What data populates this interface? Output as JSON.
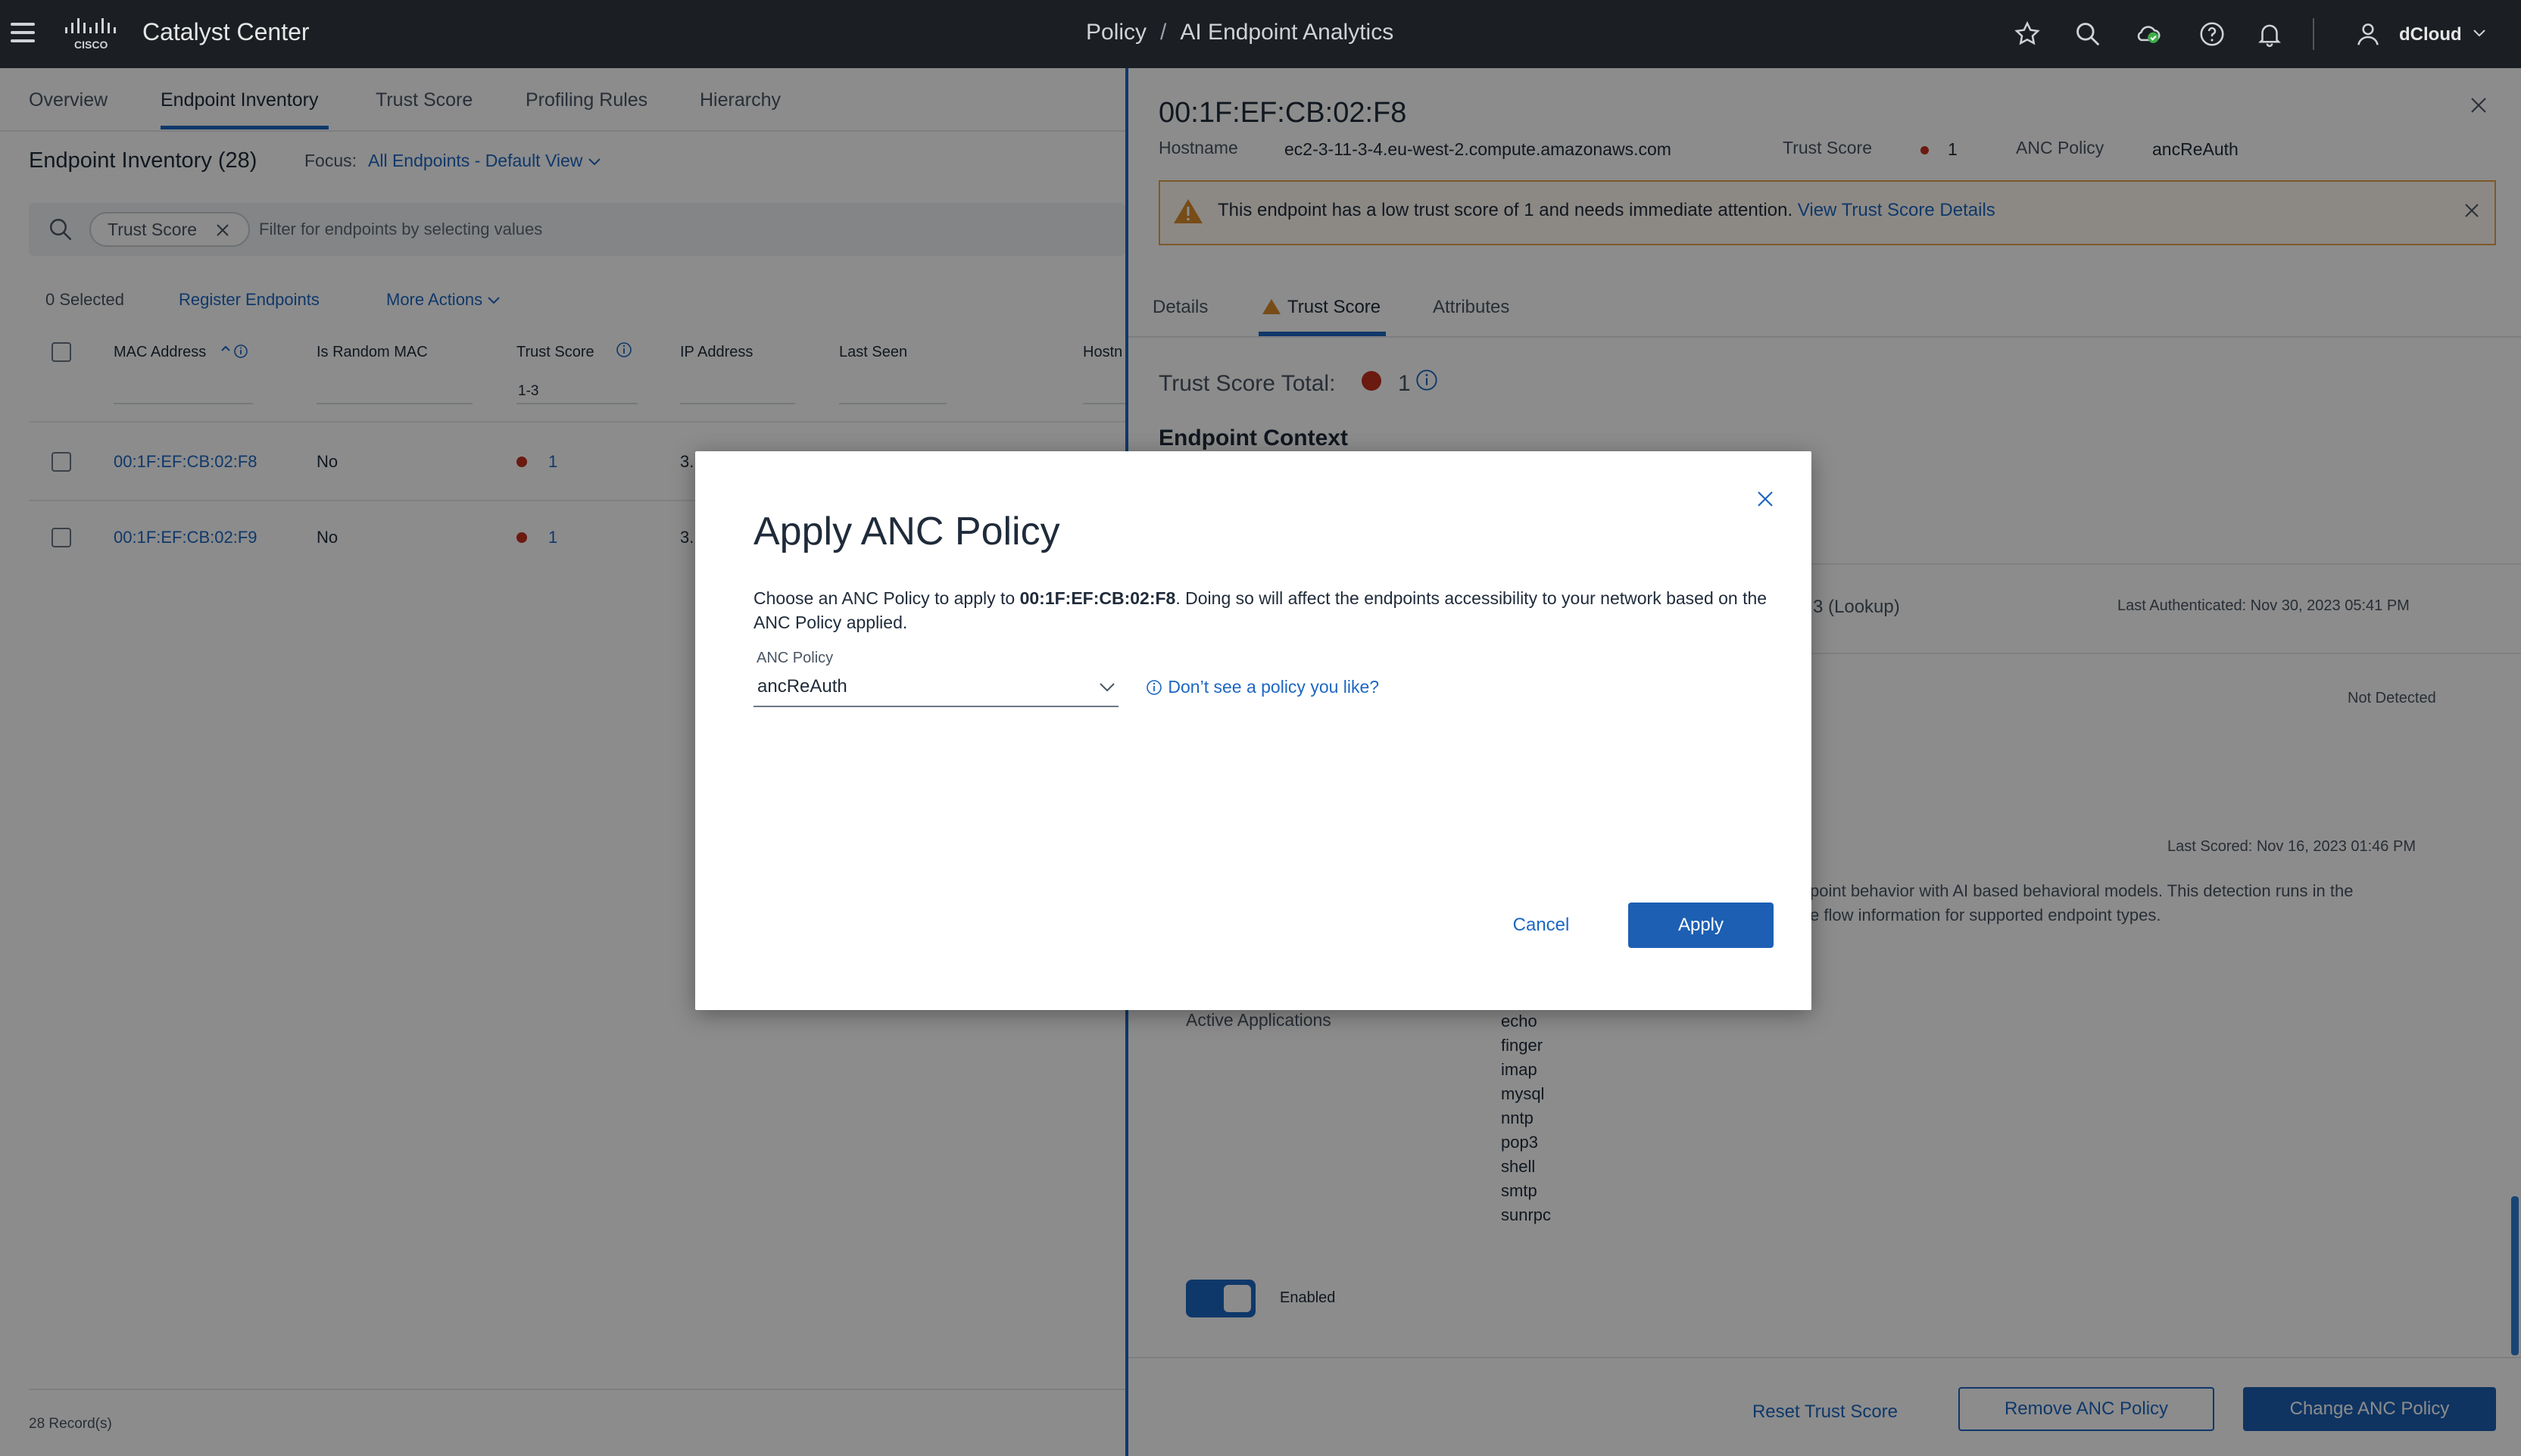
{
  "topbar": {
    "app_title": "Catalyst Center",
    "breadcrumb_1": "Policy",
    "breadcrumb_sep": "/",
    "breadcrumb_2": "AI Endpoint Analytics",
    "user_name": "dCloud"
  },
  "left": {
    "tabs": [
      "Overview",
      "Endpoint Inventory",
      "Trust Score",
      "Profiling Rules",
      "Hierarchy"
    ],
    "active_tab": "Endpoint Inventory",
    "inventory_title": "Endpoint Inventory (28)",
    "focus_label": "Focus:",
    "focus_value": "All Endpoints - Default View",
    "filter_chip": "Trust Score",
    "filter_placeholder": "Filter for endpoints by selecting values",
    "selected_count": "0 Selected",
    "register_endpoints": "Register Endpoints",
    "more_actions": "More Actions",
    "columns": [
      "MAC Address",
      "Is Random MAC",
      "Trust Score",
      "IP Address",
      "Last Seen",
      "Hostn"
    ],
    "trust_filter_value": "1-3",
    "rows": [
      {
        "mac": "00:1F:EF:CB:02:F8",
        "random": "No",
        "trust": "1",
        "ip": "3."
      },
      {
        "mac": "00:1F:EF:CB:02:F9",
        "random": "No",
        "trust": "1",
        "ip": "3."
      }
    ],
    "records": "28 Record(s)"
  },
  "right": {
    "endpoint_mac": "00:1F:EF:CB:02:F8",
    "hostname_label": "Hostname",
    "hostname_value": "ec2-3-11-3-4.eu-west-2.compute.amazonaws.com",
    "trust_label": "Trust Score",
    "trust_value": "1",
    "anc_label": "ANC Policy",
    "anc_value": "ancReAuth",
    "alert_text": "This endpoint has a low trust score of 1 and needs immediate attention.",
    "alert_link": "View Trust Score Details",
    "tabs": [
      "Details",
      "Trust Score",
      "Attributes"
    ],
    "trust_total_label": "Trust Score Total:",
    "trust_total_value": "1",
    "endpoint_context": "Endpoint Context",
    "lookup_text": "3 (Lookup)",
    "last_authenticated": "Last Authenticated: Nov 30, 2023 05:41 PM",
    "not_detected": "Not Detected",
    "last_scored": "Last Scored: Nov 16, 2023 01:46 PM",
    "behavior_line1": "point behavior with AI based behavioral models. This detection runs in the",
    "behavior_line2": "e flow information for supported endpoint types.",
    "active_apps_label": "Active Applications",
    "active_apps": [
      "echo",
      "finger",
      "imap",
      "mysql",
      "nntp",
      "pop3",
      "shell",
      "smtp",
      "sunrpc"
    ],
    "toggle_label": "Enabled",
    "toggle_on": true,
    "reset_btn": "Reset Trust Score",
    "remove_btn": "Remove ANC Policy",
    "change_btn": "Change ANC Policy"
  },
  "modal": {
    "title": "Apply ANC Policy",
    "desc_prefix": "Choose an ANC Policy to apply to ",
    "desc_mac": "00:1F:EF:CB:02:F8",
    "desc_suffix": ". Doing so will affect the endpoints accessibility to your network based on the ANC Policy applied.",
    "field_label": "ANC Policy",
    "selected_policy": "ancReAuth",
    "help_link": "Don’t see a policy you like?",
    "cancel": "Cancel",
    "apply": "Apply"
  },
  "colors": {
    "accent": "#1d67c2",
    "topbar": "#1b1f23",
    "danger_dot": "#c3301e",
    "warning": "#e3a34a"
  }
}
